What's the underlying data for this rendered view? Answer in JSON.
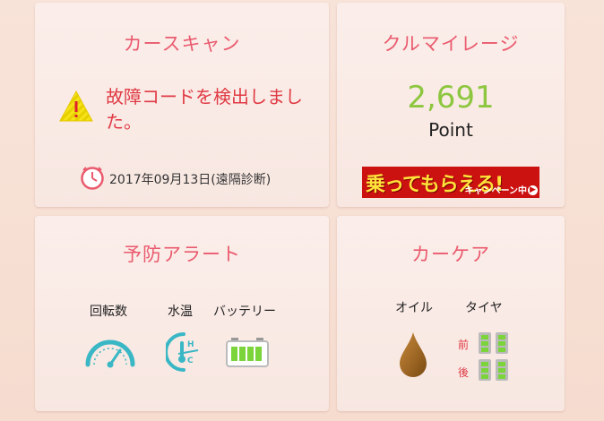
{
  "car_scan": {
    "title": "カースキャン",
    "message": "故障コードを検出しました。",
    "date": "2017年09月13日(遠隔診断)",
    "icons": [
      "warning-icon",
      "clock-icon"
    ]
  },
  "mileage": {
    "title": "クルマイレージ",
    "points": "2,691",
    "point_label": "Point",
    "banner_main": "乗ってもらえる!",
    "banner_sub": "キャンペーン中"
  },
  "alert": {
    "title": "予防アラート",
    "items": [
      {
        "label": "回転数",
        "icon": "speedometer-icon"
      },
      {
        "label": "水温",
        "icon": "thermometer-icon"
      },
      {
        "label": "バッテリー",
        "icon": "battery-icon"
      }
    ]
  },
  "care": {
    "title": "カーケア",
    "oil_label": "オイル",
    "tire_label": "タイヤ",
    "front_label": "前",
    "rear_label": "後"
  },
  "colors": {
    "accent": "#ea5a6e",
    "points": "#8dc63f",
    "warning": "#e03a44",
    "teal": "#3ab7c5"
  }
}
